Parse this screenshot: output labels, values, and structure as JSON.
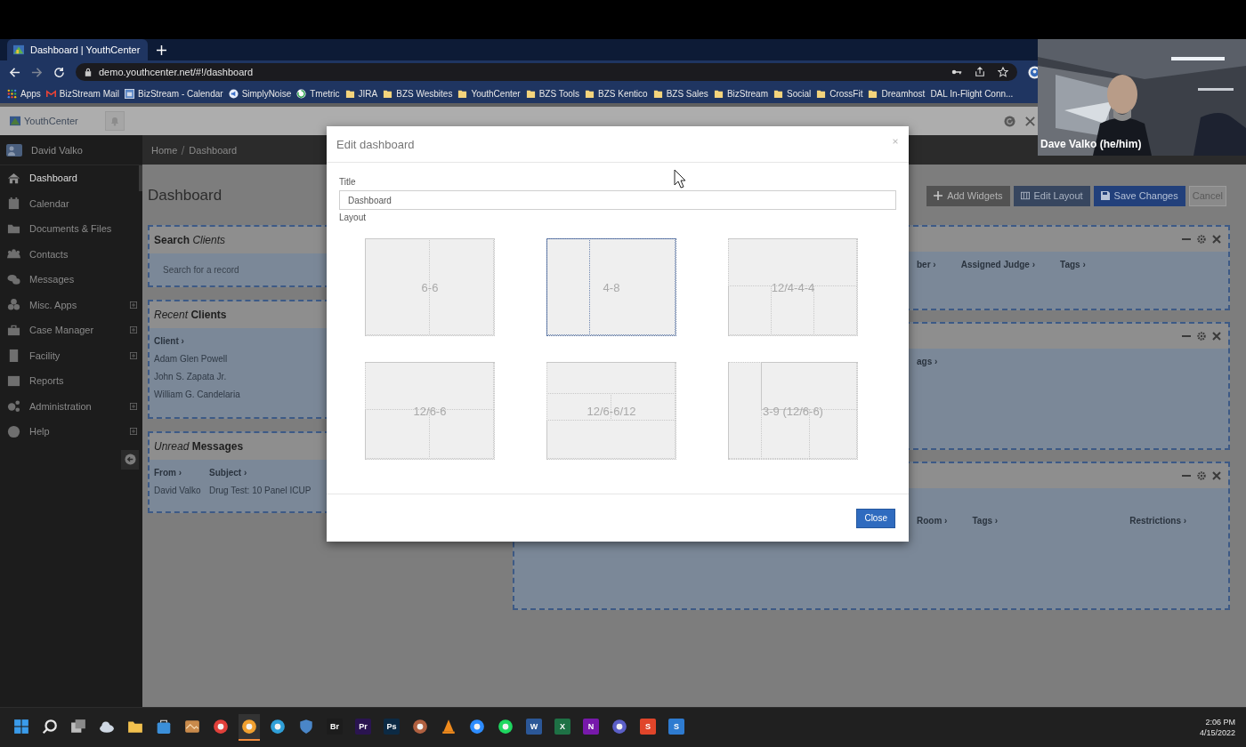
{
  "browser": {
    "tab": {
      "title": "Dashboard | YouthCenter"
    },
    "url": "demo.youthcenter.net/#!/dashboard",
    "bookmarks": [
      {
        "label": "Apps",
        "kind": "apps"
      },
      {
        "label": "BizStream Mail",
        "kind": "mail"
      },
      {
        "label": "BizStream - Calendar",
        "kind": "calendar"
      },
      {
        "label": "SimplyNoise",
        "kind": "sound"
      },
      {
        "label": "Tmetric",
        "kind": "timer"
      },
      {
        "label": "JIRA",
        "kind": "folder"
      },
      {
        "label": "BZS Wesbites",
        "kind": "folder"
      },
      {
        "label": "YouthCenter",
        "kind": "folder"
      },
      {
        "label": "BZS Tools",
        "kind": "folder"
      },
      {
        "label": "BZS Kentico",
        "kind": "folder"
      },
      {
        "label": "BZS Sales",
        "kind": "folder"
      },
      {
        "label": "BizStream",
        "kind": "folder"
      },
      {
        "label": "Social",
        "kind": "folder"
      },
      {
        "label": "CrossFit",
        "kind": "folder"
      },
      {
        "label": "Dreamhost",
        "kind": "folder"
      },
      {
        "label": "DAL In-Flight Conn...",
        "kind": "none"
      }
    ]
  },
  "video": {
    "name": "Dave Valko (he/him)"
  },
  "app": {
    "brand": "YouthCenter",
    "user": "David Valko",
    "nav": [
      {
        "label": "Dashboard",
        "kind": "home",
        "selected": true,
        "submenu": false
      },
      {
        "label": "Calendar",
        "kind": "calendar",
        "selected": false,
        "submenu": false
      },
      {
        "label": "Documents & Files",
        "kind": "folder",
        "selected": false,
        "submenu": false
      },
      {
        "label": "Contacts",
        "kind": "people",
        "selected": false,
        "submenu": false
      },
      {
        "label": "Messages",
        "kind": "chat",
        "selected": false,
        "submenu": false
      },
      {
        "label": "Misc. Apps",
        "kind": "apps",
        "selected": false,
        "submenu": true
      },
      {
        "label": "Case Manager",
        "kind": "briefcase",
        "selected": false,
        "submenu": true
      },
      {
        "label": "Facility",
        "kind": "building",
        "selected": false,
        "submenu": true
      },
      {
        "label": "Reports",
        "kind": "grid",
        "selected": false,
        "submenu": false
      },
      {
        "label": "Administration",
        "kind": "gears",
        "selected": false,
        "submenu": true
      },
      {
        "label": "Help",
        "kind": "help",
        "selected": false,
        "submenu": true
      }
    ],
    "breadcrumb": [
      "Home",
      "Dashboard"
    ],
    "heading": "Dashboard",
    "actions": [
      {
        "label": "Add Widgets",
        "kind": "add"
      },
      {
        "label": "Edit Layout",
        "kind": "layout"
      },
      {
        "label": "Save Changes",
        "kind": "save"
      },
      {
        "label": "Cancel",
        "kind": "plain"
      }
    ],
    "left_widgets": [
      {
        "title": "**Search** *Clients*",
        "kind": "search",
        "placeholder": "Search for a record"
      },
      {
        "title": "*Recent* **Clients**",
        "kind": "table",
        "columns": [
          "Client ›"
        ],
        "rows": [
          [
            "Adam Glen Powell"
          ],
          [
            "John S. Zapata Jr."
          ],
          [
            "William G. Candelaria"
          ]
        ]
      },
      {
        "title": "*Unread* **Messages**",
        "kind": "table",
        "columns": [
          "From ›",
          "Subject ›"
        ],
        "rows": [
          [
            "David Valko",
            "Drug Test: 10 Panel ICUP"
          ]
        ]
      }
    ],
    "right_widgets": [
      {
        "columns": [
          "ber ›",
          "Assigned Judge ›",
          "Tags ›"
        ]
      },
      {
        "columns": [
          "ags ›"
        ]
      },
      {
        "columns": [
          "Room ›",
          "Tags ›",
          "Restrictions ›"
        ]
      }
    ]
  },
  "modal": {
    "title": "Edit dashboard",
    "title_label": "Title",
    "title_value": "Dashboard",
    "layout_label": "Layout",
    "layouts": [
      {
        "label": "6-6",
        "kind": "halves",
        "selected": false
      },
      {
        "label": "4-8",
        "kind": "narrowleft",
        "selected": true
      },
      {
        "label": "12/4-4-4",
        "kind": "topthree",
        "selected": false
      },
      {
        "label": "12/6-6",
        "kind": "toptwo",
        "selected": false
      },
      {
        "label": "12/6-6/12",
        "kind": "sandwich",
        "selected": false
      },
      {
        "label": "3-9 (12/6-6)",
        "kind": "sidenested",
        "selected": false
      }
    ],
    "close": "Close"
  },
  "taskbar": {
    "apps": [
      {
        "kind": "windows",
        "color": "#3a9bea",
        "selected": false
      },
      {
        "kind": "search",
        "color": "#e6e6e6",
        "selected": false
      },
      {
        "kind": "windowstack",
        "color": "#bdbdbd",
        "selected": false
      },
      {
        "kind": "cloud",
        "color": "#cfd8e3",
        "selected": false
      },
      {
        "kind": "folder",
        "color": "#f2c14e",
        "selected": false
      },
      {
        "kind": "bag",
        "color": "#3b8fd9",
        "selected": false
      },
      {
        "kind": "tile",
        "color": "#c98a4b",
        "selected": false
      },
      {
        "kind": "circle",
        "color": "#e0403a",
        "selected": false
      },
      {
        "kind": "circle",
        "color": "#f0a030",
        "selected": true
      },
      {
        "kind": "circle",
        "color": "#2f9fd8",
        "selected": false
      },
      {
        "kind": "shield",
        "color": "#4a86c8",
        "selected": false
      },
      {
        "kind": "letter",
        "label": "Br",
        "color": "#1c1c1c",
        "selected": false
      },
      {
        "kind": "letter",
        "label": "Pr",
        "color": "#2a1450",
        "selected": false
      },
      {
        "kind": "letter",
        "label": "Ps",
        "color": "#0c2a44",
        "selected": false
      },
      {
        "kind": "circle",
        "color": "#b06040",
        "selected": false
      },
      {
        "kind": "cone",
        "color": "#f08a1c",
        "selected": false
      },
      {
        "kind": "circle",
        "color": "#2d8cff",
        "selected": false
      },
      {
        "kind": "circle",
        "color": "#1ed760",
        "selected": false
      },
      {
        "kind": "letter",
        "label": "W",
        "color": "#2b5797",
        "selected": false
      },
      {
        "kind": "letter",
        "label": "X",
        "color": "#1e7145",
        "selected": false
      },
      {
        "kind": "letter",
        "label": "N",
        "color": "#7719aa",
        "selected": false
      },
      {
        "kind": "circle",
        "color": "#5b5fc7",
        "selected": false
      },
      {
        "kind": "letter",
        "label": "S",
        "color": "#e0452a",
        "selected": false
      },
      {
        "kind": "letter",
        "label": "S",
        "color": "#2e7bd0",
        "selected": false
      }
    ],
    "time": "2:06 PM",
    "date": "4/15/2022"
  }
}
